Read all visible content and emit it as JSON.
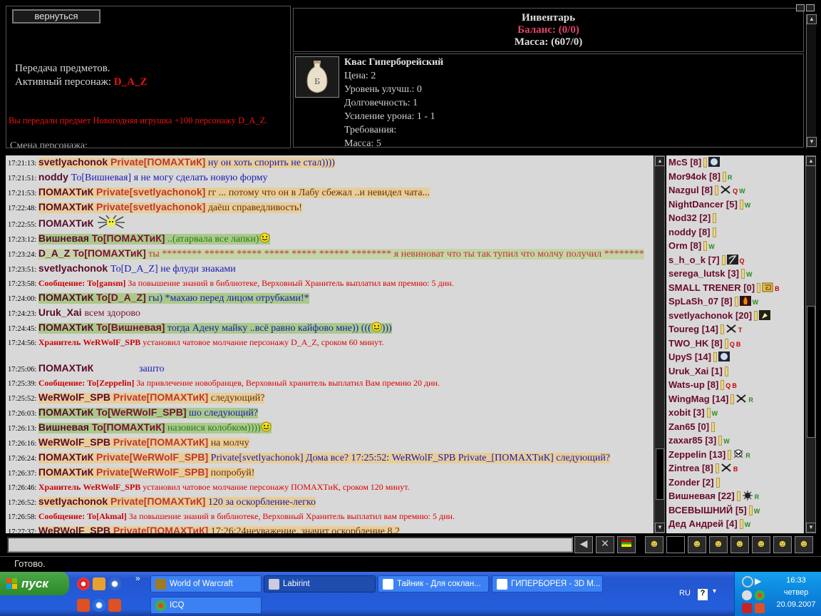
{
  "left_panel": {
    "back_label": "вернуться",
    "transfer_title": "Передача предметов.",
    "active_label": "Активный персонаж:",
    "active_name": "D_A_Z",
    "transfer_msg": "Вы передали предмет Новогодняя игрушка +100 персонажу D_A_Z.",
    "change_char": "Смена персонажа:"
  },
  "inventory": {
    "title": "Инвентарь",
    "balance": "Баланс: (0/0)",
    "mass": "Масса: (607/0)"
  },
  "item": {
    "name": "Квас Гиперборейский",
    "price": "Цена: 2",
    "upgrade": "Уровень улучш.: 0",
    "durability": "Долговечность: 1",
    "damage": "Усиление урона: 1 - 1",
    "requirements": "Требования:",
    "mass": "Масса: 5",
    "icon": "kvass-bottle-icon"
  },
  "chat": [
    {
      "time": "17:21:13:",
      "nick": "svetlyachonok",
      "to": "Private[ПОМАХТиК]",
      "to_color": "red",
      "text": " ну он хоть спорить не стал))))",
      "text_color": "blue",
      "bg": "tan"
    },
    {
      "time": "17:21:51:",
      "nick": "noddy",
      "to": "",
      "to_color": "",
      "text": "To[Вишневая] я не могу сделать новую форму",
      "text_color": "blue",
      "bg": "none"
    },
    {
      "time": "17:21:53:",
      "nick": "ПОМАХТиК",
      "to": "Private[svetlyachonok]",
      "to_color": "red",
      "text": " гг ... потому что он в Лабу сбежал ..и невидел чата...",
      "text_color": "olive",
      "bg": "tan"
    },
    {
      "time": "17:22:48:",
      "nick": "ПОМАХТиК",
      "to": "Private[svetlyachonok]",
      "to_color": "red",
      "text": " даёш справедливость!",
      "text_color": "olive",
      "bg": "tan"
    },
    {
      "time": "17:22:55:",
      "nick": "ПОМАХТиК",
      "to": "",
      "to_color": "",
      "text": "",
      "text_color": "",
      "bg": "none",
      "emote": "spider"
    },
    {
      "time": "17:23:12:",
      "nick": "Вишневая",
      "to": "To[ПОМАХТиК]",
      "to_color": "maroon",
      "text": " ..(атарвала все лапки)",
      "text_color": "green",
      "bg": "green",
      "emote": "smile"
    },
    {
      "time": "17:23:24:",
      "nick": "D_A_Z",
      "to": "To[ПОМАХТиК]",
      "to_color": "maroon",
      "text": " ты ******** ****** ***** ***** ***** ****** ******** я невиноват что ты так тупил что молчу получил ********",
      "text_color": "red",
      "bg": "green2",
      "wrap": true
    },
    {
      "time": "17:23:51:",
      "nick": "svetlyachonok",
      "to": "",
      "to_color": "",
      "text": "To[D_A_Z] не флуди знаками",
      "text_color": "blue",
      "bg": "none"
    },
    {
      "time": "17:23:58:",
      "sys": true,
      "sys_head": "Сообщение: To[gansm]",
      "sys_text": " За повышение знаний в библиотеке, Верховный Хранитель выплатил вам премию: 5 дин."
    },
    {
      "time": "17:24:00:",
      "nick": "ПОМАХТиК",
      "to": "To[D_A_Z]",
      "to_color": "maroon",
      "text": " гы) *махаю перед лицом отрубками!*",
      "text_color": "blue",
      "bg": "green"
    },
    {
      "time": "17:24:23:",
      "nick": "Uruk_Xai",
      "to": "",
      "to_color": "",
      "text": "всем здорово",
      "text_color": "maroon",
      "bg": "none"
    },
    {
      "time": "17:24:45:",
      "nick": "ПОМАХТиК",
      "to": "To[Вишневая]",
      "to_color": "maroon",
      "text": " тогда Адену майку ..всё равно кайфово мне)) (((",
      "text_color": "blue",
      "bg": "green",
      "emote": "smile",
      "tail": ")))"
    },
    {
      "time": "17:24:56:",
      "sys": true,
      "sys_head": "Хранитель WeRWolF_SPB",
      "sys_text": " установил чатовое молчание персонажу D_A_Z, сроком 60 минут."
    },
    {
      "time": "17:25:06:",
      "nick": "ПОМАХТиК",
      "to": "",
      "to_color": "",
      "text": "зашто",
      "text_color": "blue",
      "bg": "none",
      "gap": true,
      "pad": true
    },
    {
      "time": "17:25:39:",
      "sys": true,
      "sys_head": "Сообщение: To[Zeppelin]",
      "sys_text": " За привлечение новобранцев, Верховный хранитель выплатил Вам премию 20 дин."
    },
    {
      "time": "17:25:52:",
      "nick": "WeRWolF_SPB",
      "to": "Private[ПОМАХТиК]",
      "to_color": "red",
      "text": " следующий?",
      "text_color": "olive",
      "bg": "tan"
    },
    {
      "time": "17:26:03:",
      "nick": "ПОМАХТиК",
      "to": "To[WeRWolF_SPB]",
      "to_color": "maroon",
      "text": " шо следующий?",
      "text_color": "blue",
      "bg": "green"
    },
    {
      "time": "17:26:13:",
      "nick": "Вишневая",
      "to": "To[ПОМАХТиК]",
      "to_color": "maroon",
      "text": " назовися колобком))))",
      "text_color": "green",
      "bg": "green",
      "emote": "smile"
    },
    {
      "time": "17:26:16:",
      "nick": "WeRWolF_SPB",
      "to": "Private[ПОМАХТиК]",
      "to_color": "red",
      "text": " на молчу",
      "text_color": "olive",
      "bg": "tan"
    },
    {
      "time": "17:26:24:",
      "nick": "ПОМАХТиК",
      "to": "Private[WeRWolF_SPB]",
      "to_color": "red",
      "text": " Private[svetlyachonok] Дома все? 17:25:52: WeRWolF_SPB Private_[ПОМАХТиК] следующий?",
      "text_color": "blue",
      "bg": "tan",
      "wrap": true
    },
    {
      "time": "17:26:37:",
      "nick": "ПОМАХТиК",
      "to": "Private[WeRWolF_SPB]",
      "to_color": "red",
      "text": " попробуй!",
      "text_color": "olive",
      "bg": "tan"
    },
    {
      "time": "17:26:46:",
      "sys": true,
      "sys_head": "Хранитель WeRWolF_SPB",
      "sys_text": " установил чатовое молчание персонажу ПОМАХТиК, сроком 120 минут."
    },
    {
      "time": "17:26:52:",
      "nick": "svetlyachonok",
      "to": "Private[ПОМАХТиК]",
      "to_color": "red",
      "text": " 120 за оскорбление-легко",
      "text_color": "blue",
      "bg": "tan"
    },
    {
      "time": "17:26:58:",
      "sys": true,
      "sys_head": "Сообщение: To[Akmal]",
      "sys_text": " За повышение знаний в библиотеке, Верховный Хранитель выплатил вам премию: 5 дин."
    },
    {
      "time": "17:27:37:",
      "nick": "WeRWolF_SPB",
      "to": "Private[ПОМАХТиК]",
      "to_color": "red",
      "text": " 17:26:24неуважение, значит оскорбление 8.2",
      "text_color": "olive",
      "bg": "tan"
    }
  ],
  "users": [
    {
      "name": "McS",
      "level": "[8]",
      "icon": "moon-icon",
      "marks": ""
    },
    {
      "name": "Mor94ok",
      "level": "[8]",
      "icon": "",
      "marks": "R"
    },
    {
      "name": "Nazgul",
      "level": "[8]",
      "icon": "bones-icon",
      "marks": "Q W"
    },
    {
      "name": "NightDancer",
      "level": "[5]",
      "icon": "",
      "marks": "W"
    },
    {
      "name": "Nod32",
      "level": "[2]",
      "icon": "",
      "marks": ""
    },
    {
      "name": "noddy",
      "level": "[8]",
      "icon": "",
      "marks": ""
    },
    {
      "name": "Orm",
      "level": "[8]",
      "icon": "",
      "marks": "W"
    },
    {
      "name": "s_h_o_k",
      "level": "[7]",
      "icon": "scythe-icon",
      "marks": "Q"
    },
    {
      "name": "serega_lutsk",
      "level": "[3]",
      "icon": "",
      "marks": "W"
    },
    {
      "name": "SMALL TRENER",
      "level": "[0]",
      "icon": "rune-icon",
      "marks": "B"
    },
    {
      "name": "SpLaSh_07",
      "level": "[8]",
      "icon": "fire-icon",
      "marks": "W"
    },
    {
      "name": "svetlyachonok",
      "level": "[20]",
      "icon": "hand-icon",
      "marks": ""
    },
    {
      "name": "Toureg",
      "level": "[14]",
      "icon": "bones-icon",
      "marks": "T"
    },
    {
      "name": "TWO_HK",
      "level": "[8]",
      "icon": "",
      "marks": "Q B"
    },
    {
      "name": "UpyS",
      "level": "[14]",
      "icon": "moon-icon",
      "marks": ""
    },
    {
      "name": "Uruk_Xai",
      "level": "[1]",
      "icon": "",
      "marks": ""
    },
    {
      "name": "Wats-up",
      "level": "[8]",
      "icon": "",
      "marks": "Q B"
    },
    {
      "name": "WingMag",
      "level": "[14]",
      "icon": "bones-icon",
      "marks": "R"
    },
    {
      "name": "xobit",
      "level": "[3]",
      "icon": "",
      "marks": "W"
    },
    {
      "name": "Zan65",
      "level": "[0]",
      "icon": "",
      "marks": ""
    },
    {
      "name": "zaxar85",
      "level": "[3]",
      "icon": "",
      "marks": "W"
    },
    {
      "name": "Zeppelin",
      "level": "[13]",
      "icon": "skull-icon",
      "marks": "R"
    },
    {
      "name": "Zintrea",
      "level": "[8]",
      "icon": "bones-icon",
      "marks": "B"
    },
    {
      "name": "Zonder",
      "level": "[2]",
      "icon": "",
      "marks": ""
    },
    {
      "name": "Вишневая",
      "level": "[22]",
      "icon": "sun-icon",
      "marks": "R"
    },
    {
      "name": "ВСЕВЫШНИЙ",
      "level": "[5]",
      "icon": "",
      "marks": "W"
    },
    {
      "name": "Дед Андрей",
      "level": "[4]",
      "icon": "",
      "marks": "W"
    }
  ],
  "input": {
    "value": ""
  },
  "status": "Готово.",
  "taskbar": {
    "start_label": "пуск",
    "tasks": [
      {
        "label": "World of Warcraft",
        "active": false
      },
      {
        "label": "Labirint",
        "active": true
      },
      {
        "label": "Тайник - Для соклан...",
        "active": false
      },
      {
        "label": "ГИПЕРБОРЕЯ - 3D M...",
        "active": false
      },
      {
        "label": "ICQ",
        "active": false
      }
    ],
    "lang": "RU",
    "time": "16:33",
    "day": "четвер",
    "date": "20.09.2007"
  },
  "colors": {
    "nick": "#5a0a2a",
    "private": "#c0362c",
    "system": "#d00000",
    "accent_balance": "#e0446a"
  }
}
